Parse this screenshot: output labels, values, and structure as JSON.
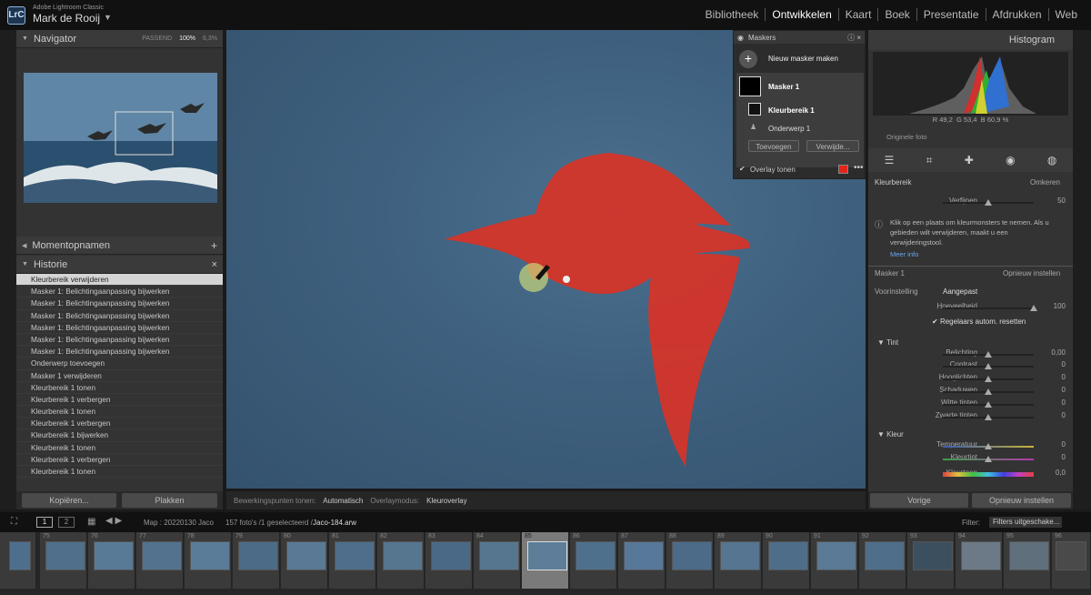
{
  "app": {
    "name": "Adobe Lightroom Classic",
    "user": "Mark de Rooij",
    "logo": "LrC"
  },
  "modules": [
    "Bibliotheek",
    "Ontwikkelen",
    "Kaart",
    "Boek",
    "Presentatie",
    "Afdrukken",
    "Web"
  ],
  "active_module": "Ontwikkelen",
  "navigator": {
    "title": "Navigator",
    "fit": "PASSEND",
    "zoom1": "100%",
    "zoom2": "6,3%"
  },
  "snapshots": {
    "title": "Momentopnamen"
  },
  "history": {
    "title": "Historie",
    "items": [
      "Kleurbereik verwijderen",
      "Masker 1: Belichtingaanpassing bijwerken",
      "Masker 1: Belichtingaanpassing bijwerken",
      "Masker 1: Belichtingaanpassing bijwerken",
      "Masker 1: Belichtingaanpassing bijwerken",
      "Masker 1: Belichtingaanpassing bijwerken",
      "Masker 1: Belichtingaanpassing bijwerken",
      "Onderwerp toevoegen",
      "Masker 1 verwijderen",
      "Kleurbereik 1 tonen",
      "Kleurbereik 1 verbergen",
      "Kleurbereik 1 tonen",
      "Kleurbereik 1 verbergen",
      "Kleurbereik 1 bijwerken",
      "Kleurbereik 1 tonen",
      "Kleurbereik 1 verbergen",
      "Kleurbereik 1 tonen"
    ]
  },
  "left_buttons": {
    "copy": "Kopiëren...",
    "paste": "Plakken"
  },
  "toolbar": {
    "label1": "Bewerkingspunten tonen:",
    "value1": "Automatisch",
    "label2": "Overlaymodus:",
    "value2": "Kleuroverlay"
  },
  "masks": {
    "title": "Maskers",
    "new": "Nieuw masker maken",
    "mask1": "Masker 1",
    "range": "Kleurbereik 1",
    "subject": "Onderwerp 1",
    "add": "Toevoegen",
    "remove": "Verwijde...",
    "overlay": "Overlay tonen",
    "overlay_color": "#e0251b"
  },
  "histogram": {
    "title": "Histogram",
    "r_label": "R",
    "r": "49,2",
    "g_label": "G",
    "g": "53,4",
    "b_label": "B",
    "b": "60,9",
    "pct": "%",
    "original": "Originele foto"
  },
  "range": {
    "label": "Kleurbereik",
    "invert": "Omkeren",
    "refine": "Verfijnen",
    "refine_val": "50",
    "refine_level": 0.5,
    "info": "Klik op een plaats om kleurmonsters te nemen. Als u gebieden wilt verwijderen, maakt u een verwijderingstool.",
    "more": "Meer info"
  },
  "mask_settings": {
    "title": "Masker 1",
    "reset": "Opnieuw instellen",
    "preset_label": "Voorinstelling",
    "preset": "Aangepast",
    "amount": "Hoeveelheid",
    "amount_val": "100",
    "auto_reset": "Regelaars autom. resetten"
  },
  "tone": {
    "title": "Tint",
    "rows": [
      {
        "label": "Belichting",
        "val": "0,00"
      },
      {
        "label": "Contrast",
        "val": "0"
      },
      {
        "label": "Hooglichten",
        "val": "0"
      },
      {
        "label": "Schaduwen",
        "val": "0"
      },
      {
        "label": "Witte tinten",
        "val": "0"
      },
      {
        "label": "Zwarte tinten",
        "val": "0"
      }
    ]
  },
  "color": {
    "title": "Kleur",
    "rows": [
      {
        "label": "Temperatuur",
        "val": "0"
      },
      {
        "label": "Kleurtint",
        "val": "0"
      },
      {
        "label": "Kleurtoon",
        "val": "0,0"
      }
    ]
  },
  "right_buttons": {
    "prev": "Vorige",
    "reset": "Opnieuw instellen"
  },
  "filmstrip": {
    "page1": "1",
    "page2": "2",
    "path": "Map : 20220130 Jaco",
    "count": "157 foto's /1 geselecteerd /",
    "file": "Jaco-184.arw",
    "filter_label": "Filter:",
    "filter": "Filters uitgeschake...",
    "numbers": [
      "75",
      "76",
      "77",
      "78",
      "79",
      "80",
      "81",
      "82",
      "83",
      "84",
      "85",
      "86",
      "87",
      "88",
      "89",
      "90",
      "91",
      "92",
      "93",
      "94",
      "95",
      "96"
    ]
  }
}
